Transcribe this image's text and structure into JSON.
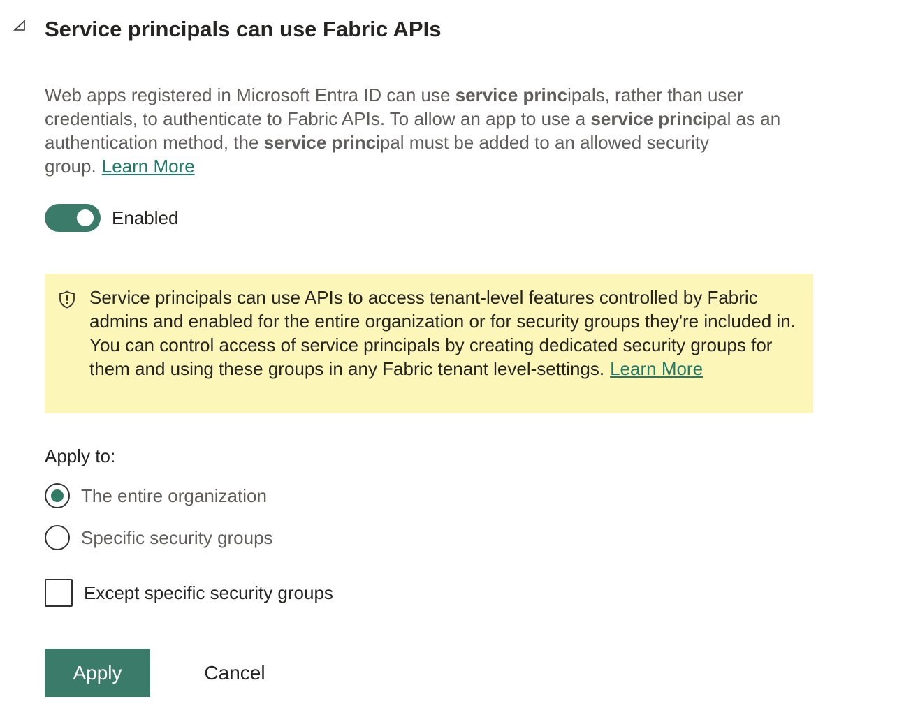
{
  "header": {
    "title_bold": "Service princ",
    "title_rest": "ipals can use Fabric APIs"
  },
  "description": {
    "seg1": "Web apps registered in Microsoft Entra ID can use ",
    "bold1": "service princ",
    "seg2": "ipals, rather than user credentials, to authenticate to Fabric APIs. To allow an app to use a ",
    "bold2": "service princ",
    "seg3": "ipal as an authentication method, the ",
    "bold3": "service princ",
    "seg4": "ipal must be added to an allowed security group.",
    "link": "Learn More"
  },
  "toggle": {
    "label": "Enabled",
    "on": true,
    "color": "#3a7b6a"
  },
  "notice": {
    "icon": "shield-icon",
    "text": "Service principals can use APIs to access tenant-level features controlled by Fabric admins and enabled for the entire organization or for security groups they're included in. You can control access of service principals by creating dedicated security groups for them and using these groups in any Fabric tenant level-settings.",
    "link": "Learn More",
    "background": "#fcf6b9"
  },
  "apply_to": {
    "label": "Apply to:",
    "options": [
      {
        "label": "The entire organization",
        "selected": true
      },
      {
        "label": "Specific security groups",
        "selected": false
      }
    ],
    "except_label": "Except specific security groups",
    "except_checked": false
  },
  "buttons": {
    "apply": "Apply",
    "cancel": "Cancel"
  },
  "colors": {
    "accent": "#3a7b6a",
    "link": "#217b6a"
  }
}
